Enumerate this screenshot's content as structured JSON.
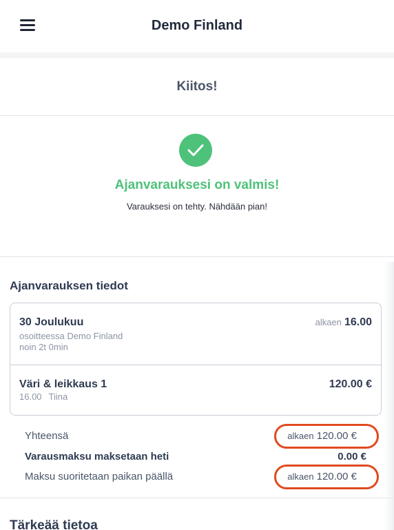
{
  "header": {
    "title": "Demo Finland",
    "menu_icon": "hamburger-menu-icon"
  },
  "confirmation": {
    "thanks": "Kiitos!",
    "icon": "check-circle-icon",
    "accent": "#4ec27a",
    "title": "Ajanvarauksesi on valmis!",
    "message": "Varauksesi on tehty. Nähdään pian!"
  },
  "booking": {
    "section_title": "Ajanvarauksen tiedot",
    "date": "30 Joulukuu",
    "location": "osoitteessa Demo Finland",
    "duration": "noin 2t 0min",
    "time_prefix": "alkaen",
    "time": "16.00",
    "service": {
      "name": "Väri & leikkaus 1",
      "time": "16.00",
      "staff": "Tiina",
      "price": "120.00 €"
    }
  },
  "summary": {
    "total_label": "Yhteensä",
    "total_prefix": "alkaen",
    "total_value": "120.00 €",
    "deposit_label": "Varausmaksu maksetaan heti",
    "deposit_value": "0.00 €",
    "onsite_label": "Maksu suoritetaan paikan päällä",
    "onsite_prefix": "alkaen",
    "onsite_value": "120.00 €",
    "highlight_color": "#e04a1f"
  },
  "info": {
    "title": "Tärkeää tietoa"
  }
}
